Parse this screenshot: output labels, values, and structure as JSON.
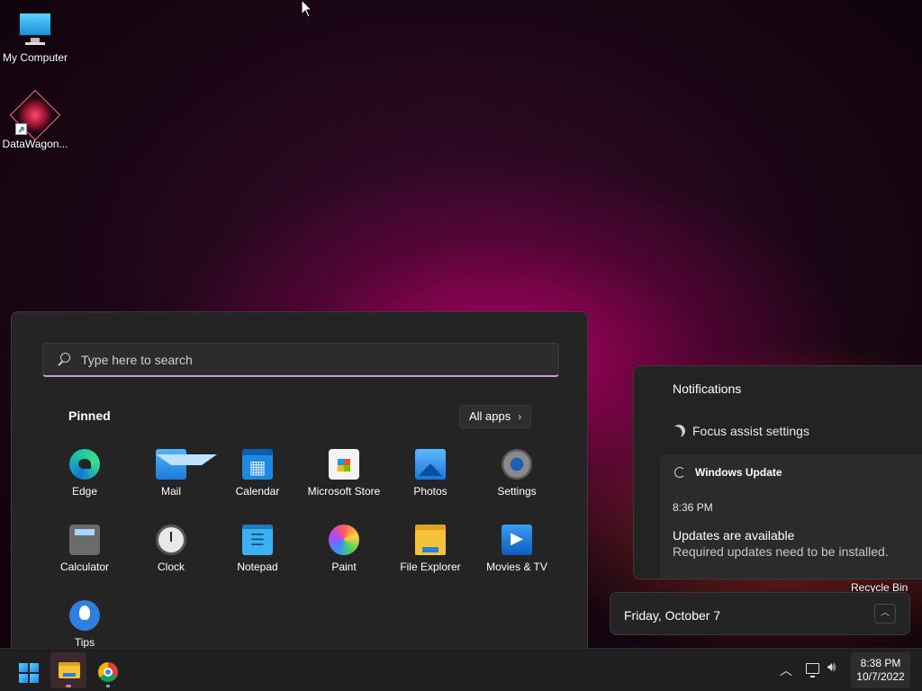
{
  "desktop": {
    "icons": [
      {
        "label": "My Computer"
      },
      {
        "label": "DataWagon..."
      }
    ],
    "recycle_bin_label": "Recycle Bin"
  },
  "start_menu": {
    "search": {
      "placeholder": "Type here to search"
    },
    "pinned_title": "Pinned",
    "all_apps_label": "All apps",
    "apps": [
      {
        "label": "Edge",
        "icon": "edge-icon"
      },
      {
        "label": "Mail",
        "icon": "mail-icon"
      },
      {
        "label": "Calendar",
        "icon": "calendar-icon"
      },
      {
        "label": "Microsoft Store",
        "icon": "store-icon"
      },
      {
        "label": "Photos",
        "icon": "photos-icon"
      },
      {
        "label": "Settings",
        "icon": "gear-icon"
      },
      {
        "label": "Calculator",
        "icon": "calculator-icon"
      },
      {
        "label": "Clock",
        "icon": "clock-icon"
      },
      {
        "label": "Notepad",
        "icon": "notepad-icon"
      },
      {
        "label": "Paint",
        "icon": "paint-icon"
      },
      {
        "label": "File Explorer",
        "icon": "folder-icon"
      },
      {
        "label": "Movies & TV",
        "icon": "movies-icon"
      },
      {
        "label": "Tips",
        "icon": "lightbulb-icon"
      }
    ]
  },
  "notifications": {
    "title": "Notifications",
    "focus_assist": "Focus assist settings",
    "update": {
      "app": "Windows Update",
      "time": "8:36 PM",
      "title": "Updates are available",
      "body": "Required updates need to be installed."
    }
  },
  "calendar_flyout": {
    "date": "Friday, October 7"
  },
  "taskbar": {
    "apps": [
      {
        "icon": "windows-start-icon"
      },
      {
        "icon": "file-explorer-icon"
      },
      {
        "icon": "chrome-icon"
      }
    ],
    "clock": {
      "time": "8:38 PM",
      "date": "10/7/2022"
    }
  },
  "colors": {
    "panel_bg": "#242424",
    "search_underline": "#c8a0d8",
    "wallpaper_accent": "#c8006e"
  }
}
